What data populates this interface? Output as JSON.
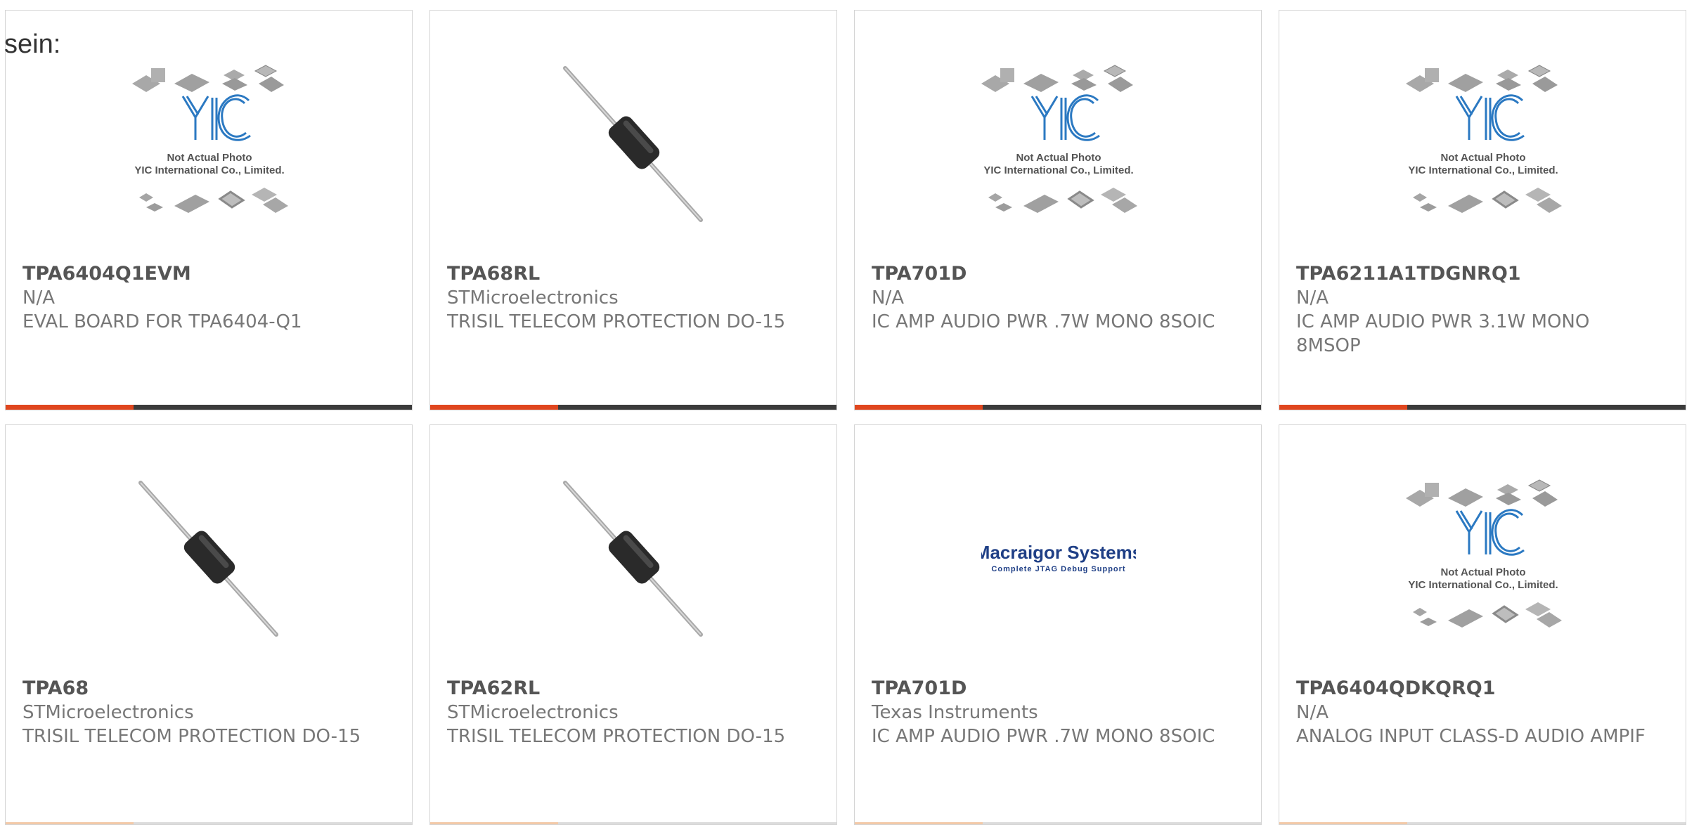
{
  "page": {
    "fragment_text": "sein:"
  },
  "colors": {
    "accent": "#e0461e",
    "bar_dark": "#3b3b3b",
    "border": "#d4d4d4"
  },
  "placeholder": {
    "line1": "Not Actual Photo",
    "line2": "YIC International Co., Limited.",
    "logo": "YIC"
  },
  "products": [
    {
      "part": "TPA6404Q1EVM",
      "manufacturer": "N/A",
      "description": "EVAL BOARD FOR TPA6404-Q1",
      "image": "yic-placeholder"
    },
    {
      "part": "TPA68RL",
      "manufacturer": "STMicroelectronics",
      "description": "TRISIL TELECOM PROTECTION DO-15",
      "image": "diode-do15"
    },
    {
      "part": "TPA701D",
      "manufacturer": "N/A",
      "description": "IC AMP AUDIO PWR .7W MONO 8SOIC",
      "image": "yic-placeholder"
    },
    {
      "part": "TPA6211A1TDGNRQ1",
      "manufacturer": "N/A",
      "description": "IC AMP AUDIO PWR 3.1W MONO 8MSOP",
      "image": "yic-placeholder"
    },
    {
      "part": "TPA68",
      "manufacturer": "STMicroelectronics",
      "description": "TRISIL TELECOM PROTECTION DO-15",
      "image": "diode-do15"
    },
    {
      "part": "TPA62RL",
      "manufacturer": "STMicroelectronics",
      "description": "TRISIL TELECOM PROTECTION DO-15",
      "image": "diode-do15"
    },
    {
      "part": "TPA701D",
      "manufacturer": "Texas Instruments",
      "description": "IC AMP AUDIO PWR .7W MONO 8SOIC",
      "image": "macraigor-logo",
      "logo_title": "Macraigor Systems",
      "logo_subtitle": "Complete JTAG Debug Support"
    },
    {
      "part": "TPA6404QDKQRQ1",
      "manufacturer": "N/A",
      "description": "ANALOG INPUT CLASS-D AUDIO AMPIF",
      "image": "yic-placeholder"
    }
  ]
}
